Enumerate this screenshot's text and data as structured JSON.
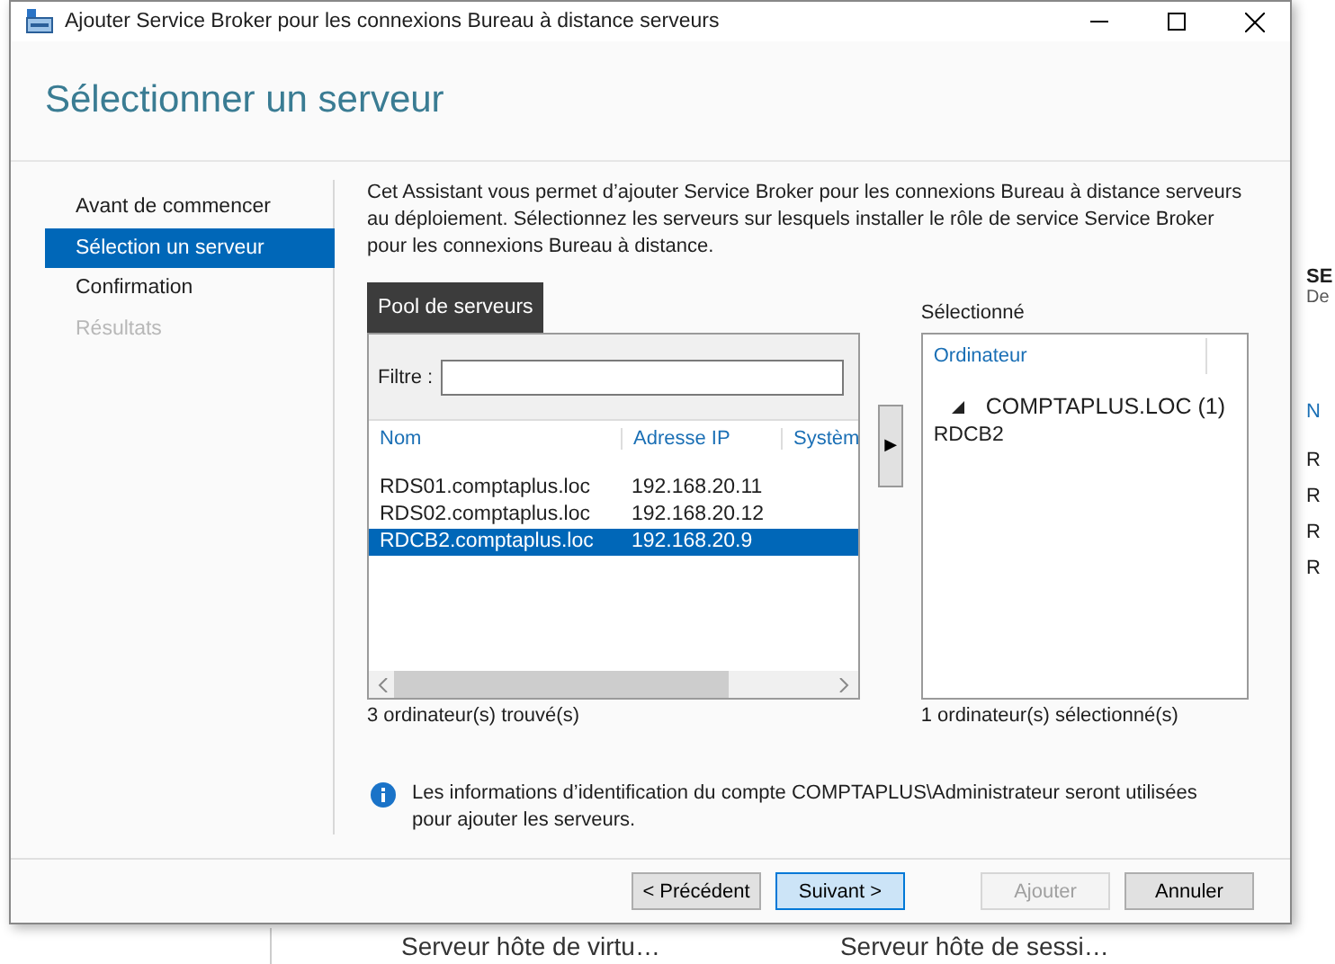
{
  "window": {
    "title": "Ajouter Service Broker pour les connexions Bureau à distance serveurs"
  },
  "heading": "Sélectionner un serveur",
  "nav": [
    {
      "label": "Avant de commencer",
      "selected": false,
      "disabled": false
    },
    {
      "label": "Sélection un serveur",
      "selected": true,
      "disabled": false
    },
    {
      "label": "Confirmation",
      "selected": false,
      "disabled": false
    },
    {
      "label": "Résultats",
      "selected": false,
      "disabled": true
    }
  ],
  "description": "Cet Assistant vous permet d’ajouter Service Broker pour les connexions Bureau à distance serveurs au déploiement. Sélectionnez les serveurs sur lesquels installer le rôle de service Service Broker pour les connexions Bureau à distance.",
  "pool": {
    "tab": "Pool de serveurs",
    "filter_label": "Filtre :",
    "columns": [
      "Nom",
      "Adresse IP",
      "Systèm"
    ],
    "rows": [
      {
        "name": "RDS01.comptaplus.loc",
        "ip": "192.168.20.11",
        "selected": false
      },
      {
        "name": "RDS02.comptaplus.loc",
        "ip": "192.168.20.12",
        "selected": false
      },
      {
        "name": "RDCB2.comptaplus.loc",
        "ip": "192.168.20.9",
        "selected": true
      }
    ],
    "count": "3 ordinateur(s) trouvé(s)"
  },
  "add_arrow": "▶",
  "selected_panel": {
    "label": "Sélectionné",
    "column": "Ordinateur",
    "groups": [
      {
        "label": "COMPTAPLUS.LOC (1)",
        "expanded": true,
        "children": [
          {
            "label": "RDCB2"
          }
        ]
      }
    ],
    "count": "1 ordinateur(s) sélectionné(s)"
  },
  "info": "Les informations d’identification du compte COMPTAPLUS\\Administrateur seront utilisées pour ajouter les serveurs.",
  "buttons": [
    {
      "label": "< Précédent",
      "default": false,
      "disabled": false
    },
    {
      "label": "Suivant >",
      "default": true,
      "disabled": false
    },
    {
      "label": "Ajouter",
      "default": false,
      "disabled": true
    },
    {
      "label": "Annuler",
      "default": false,
      "disabled": false
    }
  ],
  "background": {
    "right_fragments": [
      "SE",
      "De",
      "N",
      "R",
      "R",
      "R",
      "R"
    ],
    "bottom_labels": [
      "Serveur hôte de virtu…",
      "Serveur hôte de sessi…"
    ]
  }
}
